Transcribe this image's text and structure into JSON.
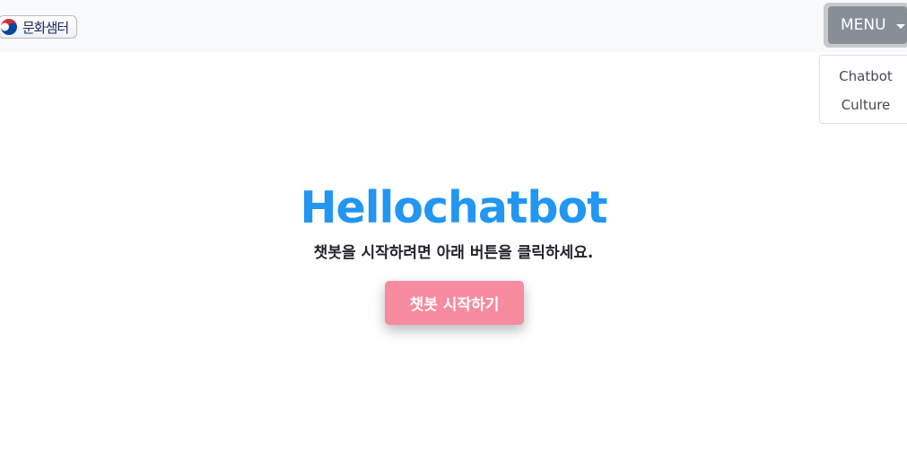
{
  "navbar": {
    "logo_text": "문화샘터",
    "logo_emblem_icon": "taegeuk-emblem-icon",
    "menu_label": "MENU",
    "menu_caret_icon": "caret-down-icon",
    "dropdown_items": [
      {
        "label": "Chatbot"
      },
      {
        "label": "Culture"
      }
    ]
  },
  "hero": {
    "title": "Hellochatbot",
    "subtitle": "챗봇을 시작하려면 아래 버튼을 클릭하세요.",
    "start_button": "챗봇 시작하기"
  },
  "colors": {
    "title_blue": "#2196f3",
    "button_pink": "#f78ba0",
    "menu_gray": "#868e96",
    "navbar_bg": "#f8f9fa"
  }
}
